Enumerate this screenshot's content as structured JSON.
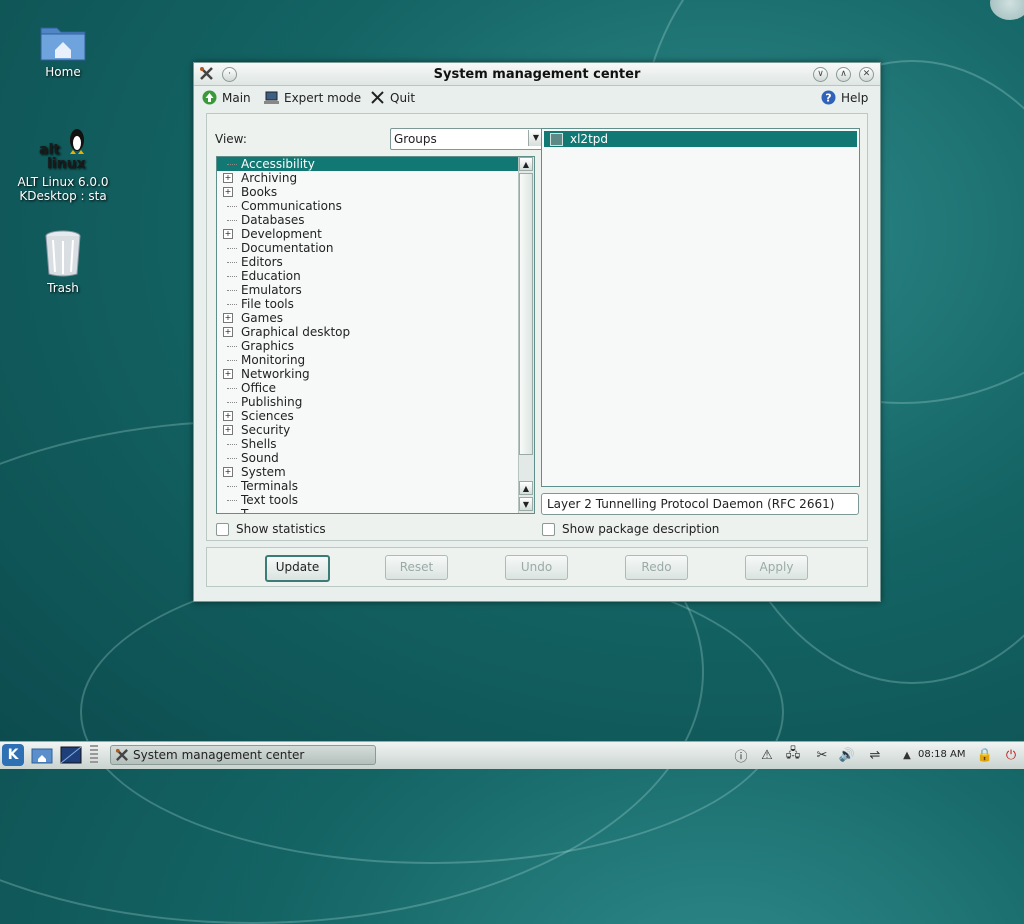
{
  "desktop": {
    "icons": [
      {
        "label": "Home"
      },
      {
        "label_line1": "ALT Linux 6.0.0",
        "label_line2": "KDesktop : sta"
      },
      {
        "label": "Trash"
      }
    ]
  },
  "window": {
    "title": "System management center",
    "toolbar": {
      "main": "Main",
      "expert_mode": "Expert mode",
      "quit": "Quit",
      "help": "Help"
    },
    "view_label": "View:",
    "view_select_value": "Groups",
    "groups": [
      {
        "label": "Accessibility",
        "expandable": false,
        "selected": true
      },
      {
        "label": "Archiving",
        "expandable": true
      },
      {
        "label": "Books",
        "expandable": true
      },
      {
        "label": "Communications",
        "expandable": false
      },
      {
        "label": "Databases",
        "expandable": false
      },
      {
        "label": "Development",
        "expandable": true
      },
      {
        "label": "Documentation",
        "expandable": false
      },
      {
        "label": "Editors",
        "expandable": false
      },
      {
        "label": "Education",
        "expandable": false
      },
      {
        "label": "Emulators",
        "expandable": false
      },
      {
        "label": "File tools",
        "expandable": false
      },
      {
        "label": "Games",
        "expandable": true
      },
      {
        "label": "Graphical desktop",
        "expandable": true
      },
      {
        "label": "Graphics",
        "expandable": false
      },
      {
        "label": "Monitoring",
        "expandable": false
      },
      {
        "label": "Networking",
        "expandable": true
      },
      {
        "label": "Office",
        "expandable": false
      },
      {
        "label": "Publishing",
        "expandable": false
      },
      {
        "label": "Sciences",
        "expandable": true
      },
      {
        "label": "Security",
        "expandable": true
      },
      {
        "label": "Shells",
        "expandable": false
      },
      {
        "label": "Sound",
        "expandable": false
      },
      {
        "label": "System",
        "expandable": true
      },
      {
        "label": "Terminals",
        "expandable": false
      },
      {
        "label": "Text tools",
        "expandable": false
      },
      {
        "label": "T...",
        "expandable": false
      }
    ],
    "packages": [
      {
        "name": "xl2tpd",
        "selected": true
      }
    ],
    "package_description": "Layer 2 Tunnelling Protocol Daemon (RFC 2661)",
    "show_statistics": "Show statistics",
    "show_package_description": "Show package description",
    "buttons": {
      "update": "Update",
      "reset": "Reset",
      "undo": "Undo",
      "redo": "Redo",
      "apply": "Apply"
    }
  },
  "taskbar": {
    "task_label": "System management center",
    "clock": "08:18 AM"
  },
  "colors": {
    "selection": "#127873",
    "desktop": "#146464"
  }
}
